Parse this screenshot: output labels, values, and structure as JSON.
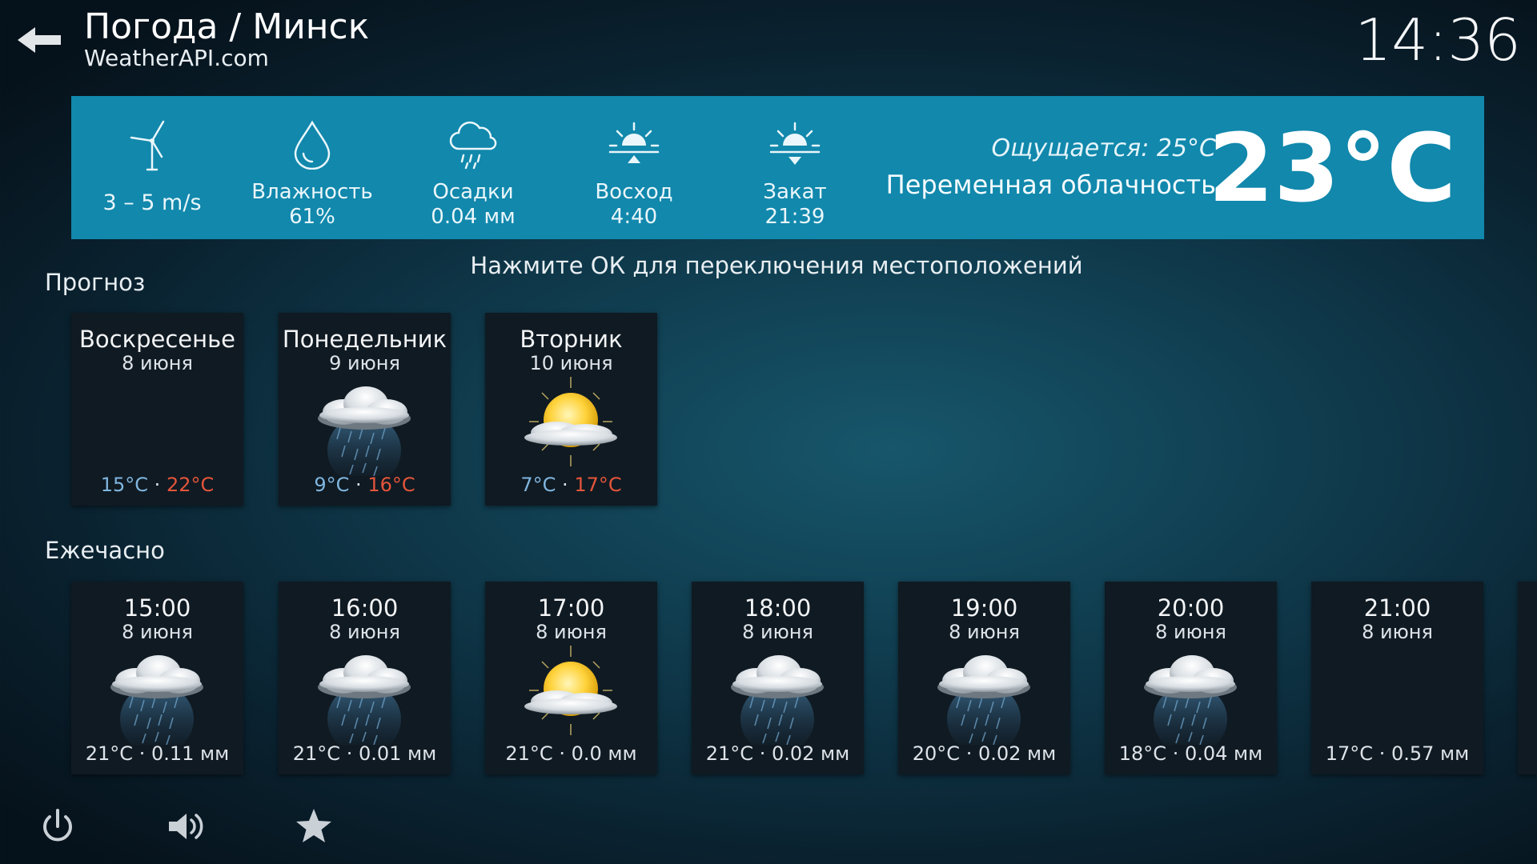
{
  "header": {
    "title": "Погода / Минск",
    "subtitle": "WeatherAPI.com",
    "clock": "14:36",
    "back_icon": "arrow-left-icon"
  },
  "current": {
    "wind": "3 – 5 m/s",
    "humidity_label": "Влажность",
    "humidity_value": "61%",
    "precip_label": "Осадки",
    "precip_value": "0.04 мм",
    "sunrise_label": "Восход",
    "sunrise_value": "4:40",
    "sunset_label": "Закат",
    "sunset_value": "21:39",
    "feels_like": "Ощущается: 25°C",
    "condition": "Переменная облачность",
    "temperature": "23°C"
  },
  "hint": "Нажмите ОК для переключения местоположений",
  "forecast": {
    "section_label": "Прогноз",
    "days": [
      {
        "day": "Воскресенье",
        "date": "8 июня",
        "low": "15°C",
        "sep": "·",
        "high": "22°C",
        "icon": "none"
      },
      {
        "day": "Понедельник",
        "date": "9 июня",
        "low": "9°C",
        "sep": "·",
        "high": "16°C",
        "icon": "rain-cloud-icon"
      },
      {
        "day": "Вторник",
        "date": "10 июня",
        "low": "7°C",
        "sep": "·",
        "high": "17°C",
        "icon": "partly-sunny-icon"
      }
    ]
  },
  "hourly": {
    "section_label": "Ежечасно",
    "hours": [
      {
        "time": "15:00",
        "date": "8 июня",
        "summary": "21°C · 0.11 мм",
        "icon": "rain-cloud-icon"
      },
      {
        "time": "16:00",
        "date": "8 июня",
        "summary": "21°C · 0.01 мм",
        "icon": "rain-cloud-icon"
      },
      {
        "time": "17:00",
        "date": "8 июня",
        "summary": "21°C · 0.0 мм",
        "icon": "partly-sunny-icon"
      },
      {
        "time": "18:00",
        "date": "8 июня",
        "summary": "21°C · 0.02 мм",
        "icon": "rain-cloud-icon"
      },
      {
        "time": "19:00",
        "date": "8 июня",
        "summary": "20°C · 0.02 мм",
        "icon": "rain-cloud-icon"
      },
      {
        "time": "20:00",
        "date": "8 июня",
        "summary": "18°C · 0.04 мм",
        "icon": "rain-cloud-icon"
      },
      {
        "time": "21:00",
        "date": "8 июня",
        "summary": "17°C · 0.57 мм",
        "icon": "none"
      }
    ]
  },
  "footer": {
    "icons": [
      "power-icon",
      "volume-icon",
      "favourites-star-icon"
    ]
  },
  "colors": {
    "bar": "#1188ac",
    "tile": "#101a22",
    "low_temp": "#7fb6e0",
    "high_temp": "#e4553b"
  }
}
